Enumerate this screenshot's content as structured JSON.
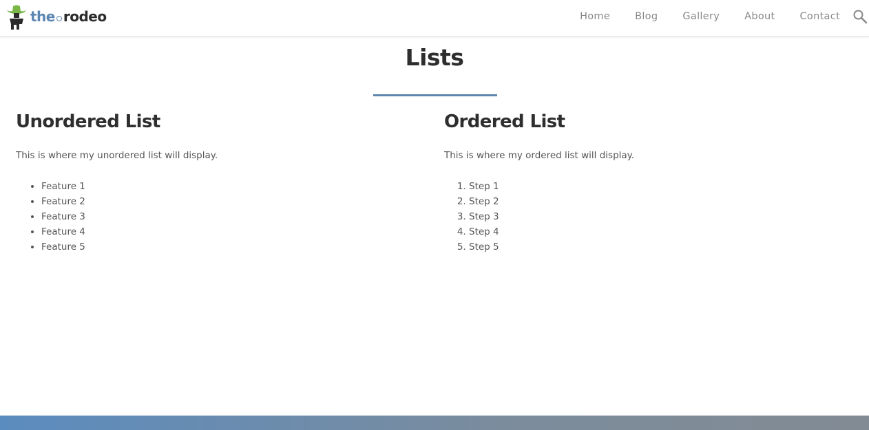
{
  "header": {
    "logo": {
      "the": "the",
      "rodeo": "rodeo"
    },
    "nav": [
      "Home",
      "Blog",
      "Gallery",
      "About",
      "Contact"
    ],
    "search_icon": "search-icon"
  },
  "page": {
    "title": "Lists"
  },
  "unordered": {
    "heading": "Unordered List",
    "description": "This is where my unordered list will display.",
    "items": [
      "Feature 1",
      "Feature 2",
      "Feature 3",
      "Feature 4",
      "Feature 5"
    ]
  },
  "ordered": {
    "heading": "Ordered List",
    "description": "This is where my ordered list will display.",
    "items": [
      "Step 1",
      "Step 2",
      "Step 3",
      "Step 4",
      "Step 5"
    ]
  },
  "colors": {
    "accent": "#5f86ad",
    "text_dark": "#2e2e2e",
    "text_body": "#555555",
    "nav": "#888888"
  }
}
